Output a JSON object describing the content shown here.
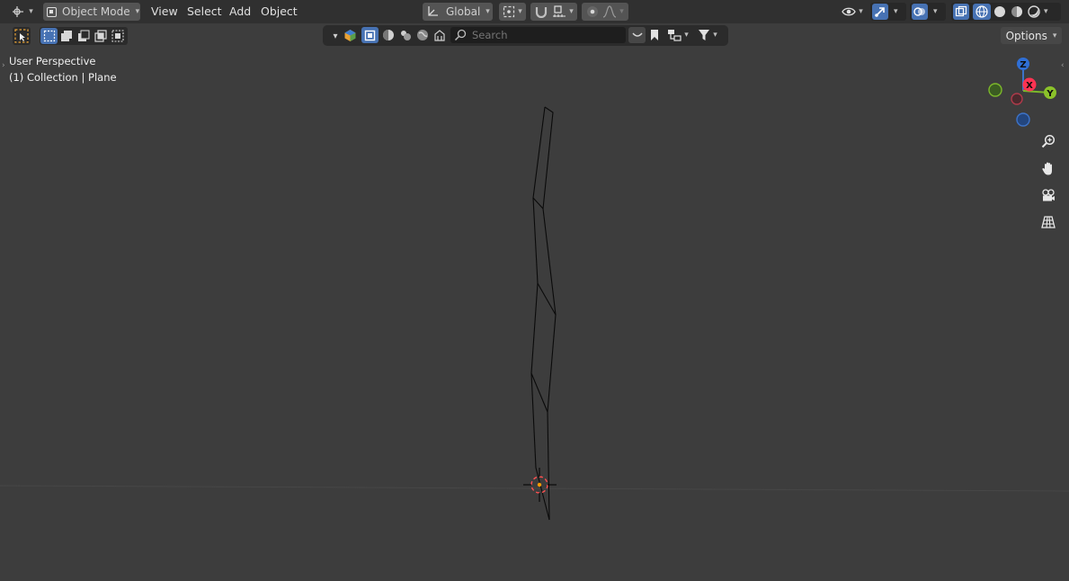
{
  "header": {
    "editor_type_icon": "viewport-editor-icon",
    "mode_label": "Object Mode",
    "menus": [
      "View",
      "Select",
      "Add",
      "Object"
    ],
    "transform_orientation": "Global"
  },
  "toolbar2": {
    "search_placeholder": "Search",
    "options_label": "Options"
  },
  "overlay": {
    "view_name": "User Perspective",
    "collection_info": "(1) Collection | Plane"
  },
  "gizmo": {
    "z_label": "Z",
    "x_label": "X",
    "y_label": "Y",
    "colors": {
      "x": "#ff3352",
      "y": "#8bdc00",
      "z": "#2890ff"
    }
  },
  "nav_buttons": [
    "zoom-icon",
    "pan-hand-icon",
    "camera-icon",
    "grid-view-icon"
  ]
}
